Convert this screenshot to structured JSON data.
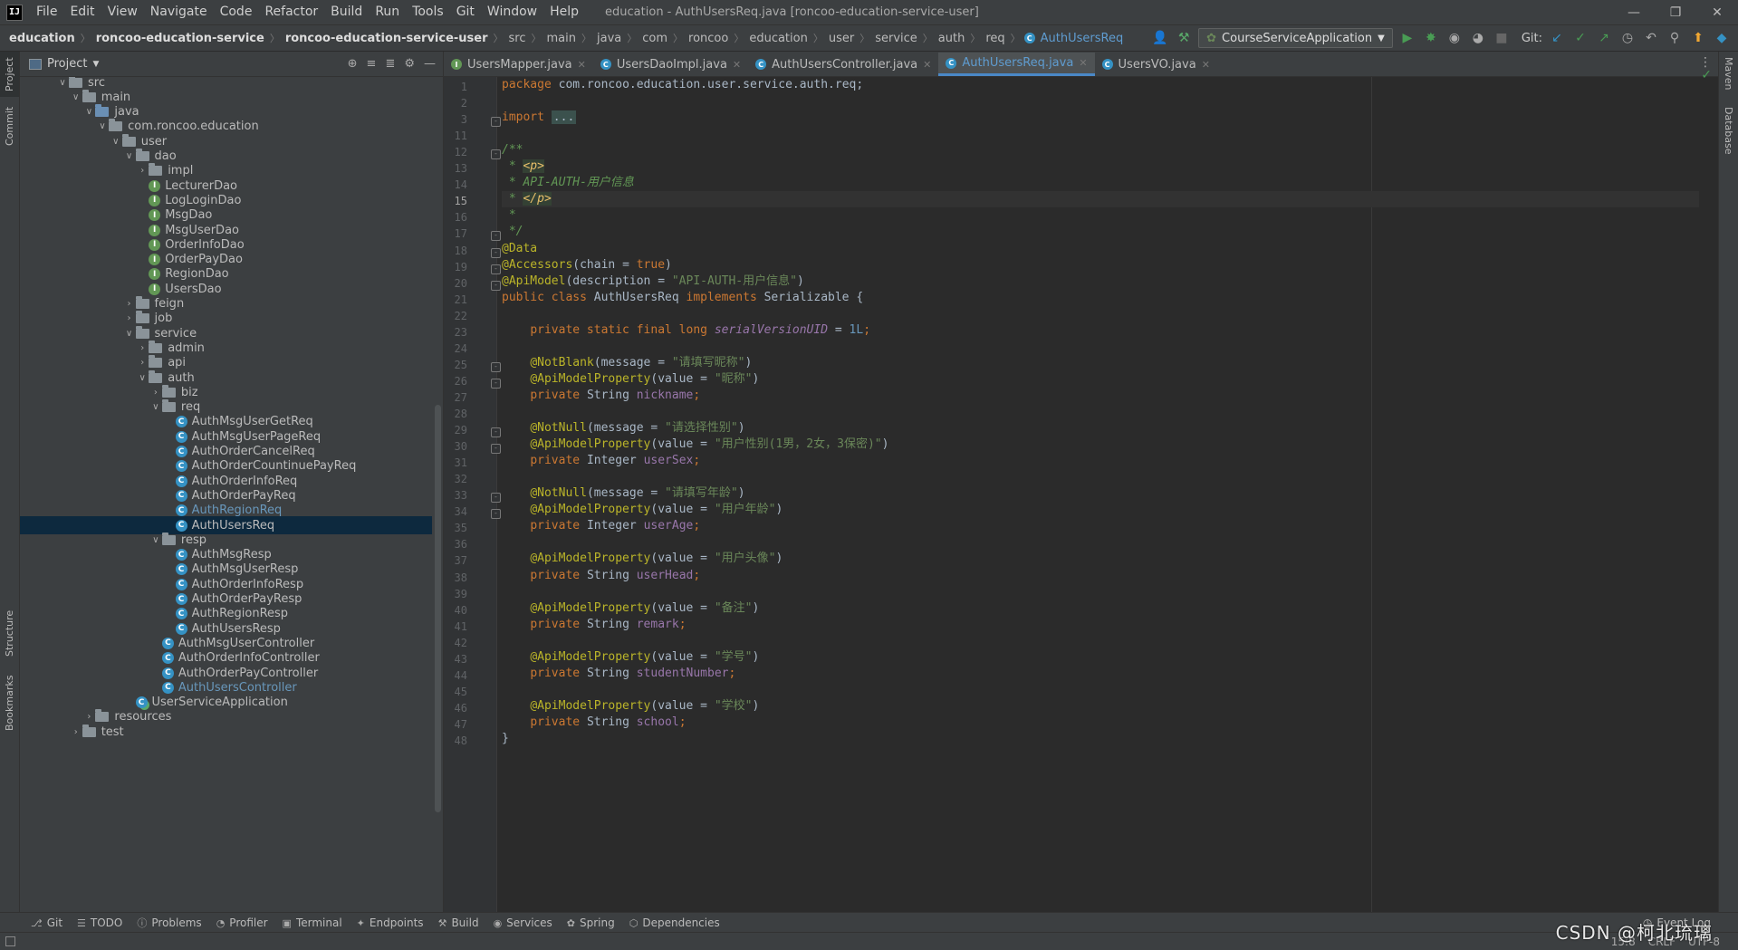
{
  "menubar": {
    "items": [
      "File",
      "Edit",
      "View",
      "Navigate",
      "Code",
      "Refactor",
      "Build",
      "Run",
      "Tools",
      "Git",
      "Window",
      "Help"
    ],
    "window_title": "education - AuthUsersReq.java [roncoo-education-service-user]"
  },
  "navbar": {
    "crumbs": [
      "education",
      "roncoo-education-service",
      "roncoo-education-service-user",
      "src",
      "main",
      "java",
      "com",
      "roncoo",
      "education",
      "user",
      "service",
      "auth",
      "req",
      "AuthUsersReq"
    ],
    "run_config": "CourseServiceApplication",
    "git_label": "Git:"
  },
  "stripes": {
    "left": [
      "Project",
      "Commit",
      "Structure",
      "Bookmarks"
    ],
    "right": [
      "Maven",
      "Database"
    ]
  },
  "project": {
    "title": "Project",
    "tree": [
      {
        "label": "src",
        "depth": 3,
        "type": "folder",
        "open": true
      },
      {
        "label": "main",
        "depth": 4,
        "type": "folder",
        "open": true
      },
      {
        "label": "java",
        "depth": 5,
        "type": "folder-blue",
        "open": true
      },
      {
        "label": "com.roncoo.education",
        "depth": 6,
        "type": "folder",
        "open": true
      },
      {
        "label": "user",
        "depth": 7,
        "type": "folder",
        "open": true
      },
      {
        "label": "dao",
        "depth": 8,
        "type": "folder",
        "open": true
      },
      {
        "label": "impl",
        "depth": 9,
        "type": "folder",
        "open": false
      },
      {
        "label": "LecturerDao",
        "depth": 9,
        "type": "iface"
      },
      {
        "label": "LogLoginDao",
        "depth": 9,
        "type": "iface"
      },
      {
        "label": "MsgDao",
        "depth": 9,
        "type": "iface"
      },
      {
        "label": "MsgUserDao",
        "depth": 9,
        "type": "iface"
      },
      {
        "label": "OrderInfoDao",
        "depth": 9,
        "type": "iface"
      },
      {
        "label": "OrderPayDao",
        "depth": 9,
        "type": "iface"
      },
      {
        "label": "RegionDao",
        "depth": 9,
        "type": "iface"
      },
      {
        "label": "UsersDao",
        "depth": 9,
        "type": "iface"
      },
      {
        "label": "feign",
        "depth": 8,
        "type": "folder",
        "open": false
      },
      {
        "label": "job",
        "depth": 8,
        "type": "folder",
        "open": false
      },
      {
        "label": "service",
        "depth": 8,
        "type": "folder",
        "open": true
      },
      {
        "label": "admin",
        "depth": 9,
        "type": "folder",
        "open": false
      },
      {
        "label": "api",
        "depth": 9,
        "type": "folder",
        "open": false
      },
      {
        "label": "auth",
        "depth": 9,
        "type": "folder",
        "open": true
      },
      {
        "label": "biz",
        "depth": 10,
        "type": "folder",
        "open": false
      },
      {
        "label": "req",
        "depth": 10,
        "type": "folder",
        "open": true
      },
      {
        "label": "AuthMsgUserGetReq",
        "depth": 11,
        "type": "class"
      },
      {
        "label": "AuthMsgUserPageReq",
        "depth": 11,
        "type": "class"
      },
      {
        "label": "AuthOrderCancelReq",
        "depth": 11,
        "type": "class"
      },
      {
        "label": "AuthOrderCountinuePayReq",
        "depth": 11,
        "type": "class"
      },
      {
        "label": "AuthOrderInfoReq",
        "depth": 11,
        "type": "class"
      },
      {
        "label": "AuthOrderPayReq",
        "depth": 11,
        "type": "class"
      },
      {
        "label": "AuthRegionReq",
        "depth": 11,
        "type": "class",
        "highlight": true
      },
      {
        "label": "AuthUsersReq",
        "depth": 11,
        "type": "class",
        "selected": true
      },
      {
        "label": "resp",
        "depth": 10,
        "type": "folder",
        "open": true
      },
      {
        "label": "AuthMsgResp",
        "depth": 11,
        "type": "class"
      },
      {
        "label": "AuthMsgUserResp",
        "depth": 11,
        "type": "class"
      },
      {
        "label": "AuthOrderInfoResp",
        "depth": 11,
        "type": "class"
      },
      {
        "label": "AuthOrderPayResp",
        "depth": 11,
        "type": "class"
      },
      {
        "label": "AuthRegionResp",
        "depth": 11,
        "type": "class"
      },
      {
        "label": "AuthUsersResp",
        "depth": 11,
        "type": "class"
      },
      {
        "label": "AuthMsgUserController",
        "depth": 10,
        "type": "class"
      },
      {
        "label": "AuthOrderInfoController",
        "depth": 10,
        "type": "class"
      },
      {
        "label": "AuthOrderPayController",
        "depth": 10,
        "type": "class"
      },
      {
        "label": "AuthUsersController",
        "depth": 10,
        "type": "class",
        "highlight": true
      },
      {
        "label": "UserServiceApplication",
        "depth": 8,
        "type": "app"
      },
      {
        "label": "resources",
        "depth": 5,
        "type": "folder",
        "open": false
      },
      {
        "label": "test",
        "depth": 4,
        "type": "folder",
        "open": false
      }
    ]
  },
  "editor": {
    "tabs": [
      {
        "label": "UsersMapper.java",
        "icon": "iface",
        "active": false
      },
      {
        "label": "UsersDaoImpl.java",
        "icon": "class",
        "active": false
      },
      {
        "label": "AuthUsersController.java",
        "icon": "class",
        "active": false
      },
      {
        "label": "AuthUsersReq.java",
        "icon": "class",
        "active": true
      },
      {
        "label": "UsersVO.java",
        "icon": "class",
        "active": false
      }
    ],
    "line_numbers": [
      1,
      2,
      3,
      11,
      12,
      13,
      14,
      15,
      16,
      17,
      18,
      19,
      20,
      21,
      22,
      23,
      24,
      25,
      26,
      27,
      28,
      29,
      30,
      31,
      32,
      33,
      34,
      35,
      36,
      37,
      38,
      39,
      40,
      41,
      42,
      43,
      44,
      45,
      46,
      47,
      48
    ],
    "current_line": 15,
    "code_lines": [
      [
        [
          "k",
          "package "
        ],
        [
          "p",
          "com.roncoo.education.user.service.auth.req;"
        ]
      ],
      [],
      [
        [
          "k",
          "import "
        ],
        [
          "fold",
          "..."
        ]
      ],
      [],
      [
        [
          "c",
          "/**"
        ]
      ],
      [
        [
          "c",
          " * "
        ],
        [
          "ct",
          "<p>"
        ]
      ],
      [
        [
          "c",
          " * API-AUTH-用户信息"
        ]
      ],
      [
        [
          "c",
          " * "
        ],
        [
          "ct",
          "</p>"
        ]
      ],
      [
        [
          "c",
          " *"
        ]
      ],
      [
        [
          "c",
          " */"
        ]
      ],
      [
        [
          "a",
          "@Data"
        ]
      ],
      [
        [
          "a",
          "@Accessors"
        ],
        [
          "p",
          "(chain = "
        ],
        [
          "k",
          "true"
        ],
        [
          "p",
          ")"
        ]
      ],
      [
        [
          "a",
          "@ApiModel"
        ],
        [
          "p",
          "(description = "
        ],
        [
          "s",
          "\"API-AUTH-用户信息\""
        ],
        [
          "p",
          ")"
        ]
      ],
      [
        [
          "k",
          "public class "
        ],
        [
          "p",
          "AuthUsersReq "
        ],
        [
          "k",
          "implements "
        ],
        [
          "p",
          "Serializable {"
        ]
      ],
      [],
      [
        [
          "p",
          "    "
        ],
        [
          "k",
          "private static final long "
        ],
        [
          "fi",
          "serialVersionUID"
        ],
        [
          "p",
          " = "
        ],
        [
          "n",
          "1L"
        ],
        [
          "k",
          ";"
        ]
      ],
      [],
      [
        [
          "p",
          "    "
        ],
        [
          "a",
          "@NotBlank"
        ],
        [
          "p",
          "(message = "
        ],
        [
          "s",
          "\"请填写昵称\""
        ],
        [
          "p",
          ")"
        ]
      ],
      [
        [
          "p",
          "    "
        ],
        [
          "a",
          "@ApiModelProperty"
        ],
        [
          "p",
          "(value = "
        ],
        [
          "s",
          "\"昵称\""
        ],
        [
          "p",
          ")"
        ]
      ],
      [
        [
          "p",
          "    "
        ],
        [
          "k",
          "private "
        ],
        [
          "p",
          "String "
        ],
        [
          "f",
          "nickname"
        ],
        [
          "k",
          ";"
        ]
      ],
      [],
      [
        [
          "p",
          "    "
        ],
        [
          "a",
          "@NotNull"
        ],
        [
          "p",
          "(message = "
        ],
        [
          "s",
          "\"请选择性别\""
        ],
        [
          "p",
          ")"
        ]
      ],
      [
        [
          "p",
          "    "
        ],
        [
          "a",
          "@ApiModelProperty"
        ],
        [
          "p",
          "(value = "
        ],
        [
          "s",
          "\"用户性别(1男，2女，3保密)\""
        ],
        [
          "p",
          ")"
        ]
      ],
      [
        [
          "p",
          "    "
        ],
        [
          "k",
          "private "
        ],
        [
          "p",
          "Integer "
        ],
        [
          "f",
          "userSex"
        ],
        [
          "k",
          ";"
        ]
      ],
      [],
      [
        [
          "p",
          "    "
        ],
        [
          "a",
          "@NotNull"
        ],
        [
          "p",
          "(message = "
        ],
        [
          "s",
          "\"请填写年龄\""
        ],
        [
          "p",
          ")"
        ]
      ],
      [
        [
          "p",
          "    "
        ],
        [
          "a",
          "@ApiModelProperty"
        ],
        [
          "p",
          "(value = "
        ],
        [
          "s",
          "\"用户年龄\""
        ],
        [
          "p",
          ")"
        ]
      ],
      [
        [
          "p",
          "    "
        ],
        [
          "k",
          "private "
        ],
        [
          "p",
          "Integer "
        ],
        [
          "f",
          "userAge"
        ],
        [
          "k",
          ";"
        ]
      ],
      [],
      [
        [
          "p",
          "    "
        ],
        [
          "a",
          "@ApiModelProperty"
        ],
        [
          "p",
          "(value = "
        ],
        [
          "s",
          "\"用户头像\""
        ],
        [
          "p",
          ")"
        ]
      ],
      [
        [
          "p",
          "    "
        ],
        [
          "k",
          "private "
        ],
        [
          "p",
          "String "
        ],
        [
          "f",
          "userHead"
        ],
        [
          "k",
          ";"
        ]
      ],
      [],
      [
        [
          "p",
          "    "
        ],
        [
          "a",
          "@ApiModelProperty"
        ],
        [
          "p",
          "(value = "
        ],
        [
          "s",
          "\"备注\""
        ],
        [
          "p",
          ")"
        ]
      ],
      [
        [
          "p",
          "    "
        ],
        [
          "k",
          "private "
        ],
        [
          "p",
          "String "
        ],
        [
          "f",
          "remark"
        ],
        [
          "k",
          ";"
        ]
      ],
      [],
      [
        [
          "p",
          "    "
        ],
        [
          "a",
          "@ApiModelProperty"
        ],
        [
          "p",
          "(value = "
        ],
        [
          "s",
          "\"学号\""
        ],
        [
          "p",
          ")"
        ]
      ],
      [
        [
          "p",
          "    "
        ],
        [
          "k",
          "private "
        ],
        [
          "p",
          "String "
        ],
        [
          "f",
          "studentNumber"
        ],
        [
          "k",
          ";"
        ]
      ],
      [],
      [
        [
          "p",
          "    "
        ],
        [
          "a",
          "@ApiModelProperty"
        ],
        [
          "p",
          "(value = "
        ],
        [
          "s",
          "\"学校\""
        ],
        [
          "p",
          ")"
        ]
      ],
      [
        [
          "p",
          "    "
        ],
        [
          "k",
          "private "
        ],
        [
          "p",
          "String "
        ],
        [
          "f",
          "school"
        ],
        [
          "k",
          ";"
        ]
      ],
      [
        [
          "p",
          "}"
        ]
      ]
    ]
  },
  "bottom_tools": [
    "Git",
    "TODO",
    "Problems",
    "Profiler",
    "Terminal",
    "Endpoints",
    "Build",
    "Services",
    "Spring",
    "Dependencies"
  ],
  "event_log": "Event Log",
  "status": {
    "position": "15:8",
    "line_sep": "CRLF",
    "encoding": "UTF-8",
    "watermark": "CSDN @柯北琉璃"
  }
}
